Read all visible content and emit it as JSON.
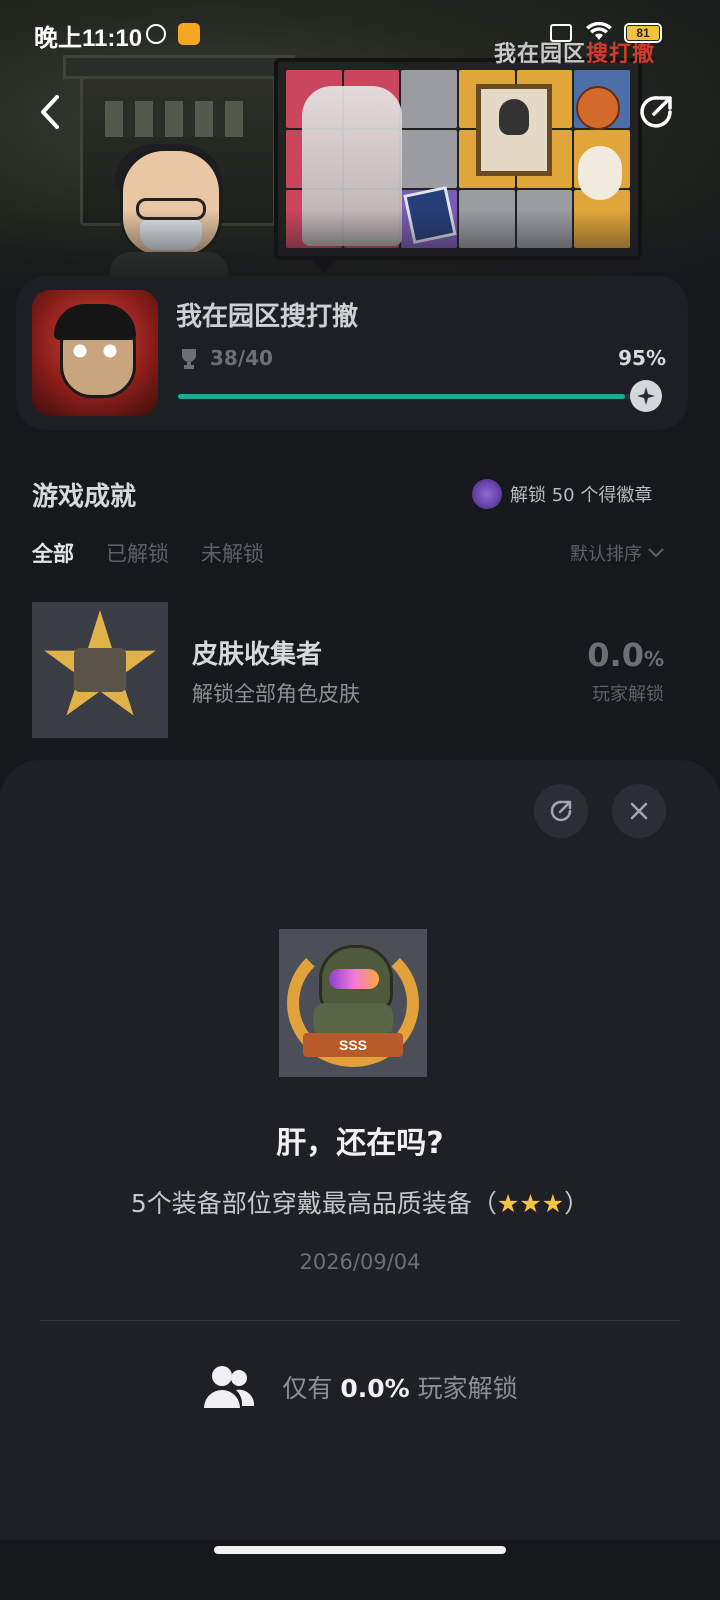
{
  "status_bar": {
    "time": "晚上11:10",
    "battery": "81",
    "wifi": "wifi-icon",
    "alarm": "alarm-icon"
  },
  "hero": {
    "logo_text_a": "我在园区",
    "logo_text_b": "搜打撤"
  },
  "game": {
    "title": "我在园区搜打撤",
    "trophy_count": "38/40",
    "completion": "95%",
    "progress_fraction": 0.95
  },
  "achievements": {
    "section_title": "游戏成就",
    "badge_hint": "解锁 50 个得徽章",
    "tabs": [
      "全部",
      "已解锁",
      "未解锁"
    ],
    "sort_label": "默认排序",
    "items": [
      {
        "name": "皮肤收集者",
        "description": "解锁全部角色皮肤",
        "percent": "0.0",
        "percent_unit": "%",
        "percent_label": "玩家解锁"
      }
    ]
  },
  "detail_sheet": {
    "badge_text": "SSS",
    "title": "肝，还在吗?",
    "description_prefix": "5个装备部位穿戴最高品质装备（",
    "description_stars": "★★★",
    "description_suffix": "）",
    "date": "2026/09/04",
    "unlock_prefix": "仅有",
    "unlock_percent": "0.0%",
    "unlock_suffix": "玩家解锁"
  },
  "colors": {
    "background": "#17181c",
    "card": "#1d1f24",
    "sheet": "#1f2026",
    "accent_progress": "#20a896",
    "star": "#f6c344"
  }
}
